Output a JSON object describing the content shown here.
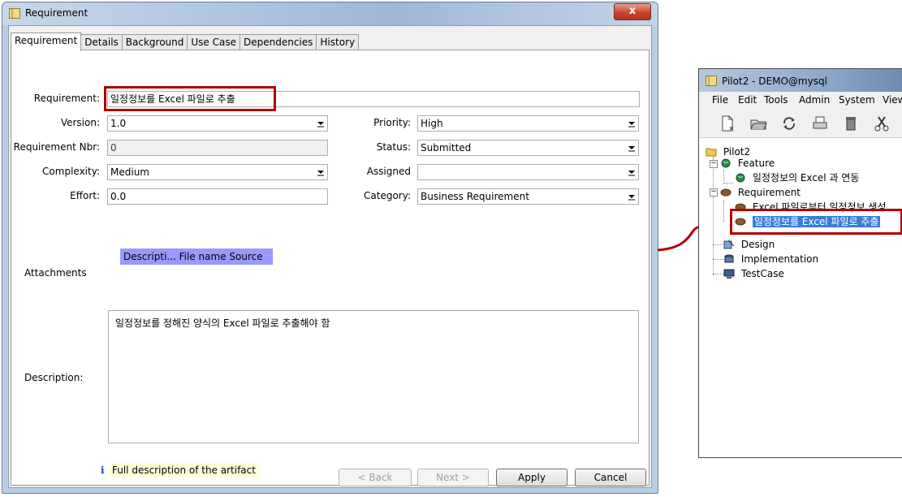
{
  "dialog": {
    "title": "Requirement",
    "close_label": "x",
    "tabs": [
      "Requirement",
      "Details",
      "Background",
      "Use Case",
      "Dependencies",
      "History"
    ],
    "fields": {
      "requirement_label": "Requirement:",
      "requirement_value": "일정정보를 Excel 파일로 추출",
      "version_label": "Version:",
      "version_value": "1.0",
      "nbr_label": "Requirement Nbr:",
      "nbr_value": "0",
      "complexity_label": "Complexity:",
      "complexity_value": "Medium",
      "effort_label": "Effort:",
      "effort_value": "0.0",
      "priority_label": "Priority:",
      "priority_value": "High",
      "status_label": "Status:",
      "status_value": "Submitted",
      "assigned_label": "Assigned",
      "assigned_value": "",
      "category_label": "Category:",
      "category_value": "Business Requirement"
    },
    "attachments_label": "Attachments",
    "attachments_header": "Descripti... File name  Source",
    "description_label": "Description:",
    "description_value": "일정정보를 정해진 양식의 Excel 파일로 추출해야 함",
    "info_icon": "i",
    "info_text": "Full description of the artifact",
    "buttons": {
      "back": "< Back",
      "next": "Next >",
      "apply": "Apply",
      "cancel": "Cancel"
    },
    "highlight_color": "#b00000"
  },
  "pilot": {
    "title": "Pilot2 - DEMO@mysql",
    "menu": [
      "File",
      "Edit",
      "Tools",
      "Admin",
      "System",
      "View"
    ],
    "toolbar_icons": [
      "new-document-icon",
      "open-folder-icon",
      "refresh-icon",
      "print-icon",
      "delete-icon",
      "cut-icon"
    ],
    "tree": {
      "root": "Pilot2",
      "feature": "Feature",
      "feature_child": "일정정보의 Excel 과 연동",
      "requirement": "Requirement",
      "req_child_1": "Excel 파일로부터 일정정보 생성",
      "req_child_2": "일정정보를 Excel 파일로 추출",
      "design": "Design",
      "implementation": "Implementation",
      "testcase": "TestCase"
    },
    "selection_color": "#3b7dd8"
  }
}
